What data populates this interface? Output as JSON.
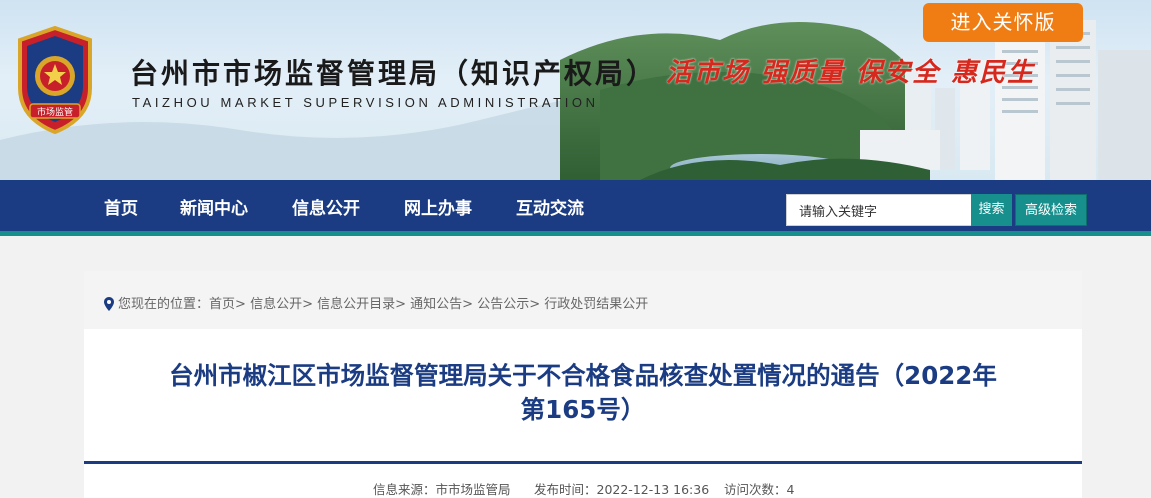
{
  "header": {
    "site_title": "台州市市场监督管理局（知识产权局）",
    "site_subtitle": "TAIZHOU MARKET SUPERVISION ADMINISTRATION",
    "slogan": "活市场  强质量  保安全  惠民生",
    "emblem_text": "市场监管",
    "care_mode_label": "进入关怀版"
  },
  "nav": {
    "items": [
      {
        "label": "首页"
      },
      {
        "label": "新闻中心"
      },
      {
        "label": "信息公开"
      },
      {
        "label": "网上办事"
      },
      {
        "label": "互动交流"
      }
    ],
    "search": {
      "value": "请输入关键字",
      "button_label": "搜索",
      "advanced_label": "高级检索"
    }
  },
  "breadcrumb": {
    "prefix": "您现在的位置：",
    "items": [
      "首页",
      "信息公开",
      "信息公开目录",
      "通知公告",
      "公告公示",
      "行政处罚结果公开"
    ],
    "separator": "> "
  },
  "article": {
    "title_line1": "台州市椒江区市场监督管理局关于不合格食品核查处置情况的通告（2022年",
    "title_line2": "第165号）",
    "source": "信息来源：市市场监管局",
    "published": "发布时间：2022-12-13 16:36",
    "views": "访问次数：4"
  },
  "colors": {
    "nav_bg": "#1b3c82",
    "accent_teal": "#178f8d",
    "care_button": "#f07d13",
    "slogan_red": "#d6281d",
    "title_blue": "#1b3c82"
  }
}
